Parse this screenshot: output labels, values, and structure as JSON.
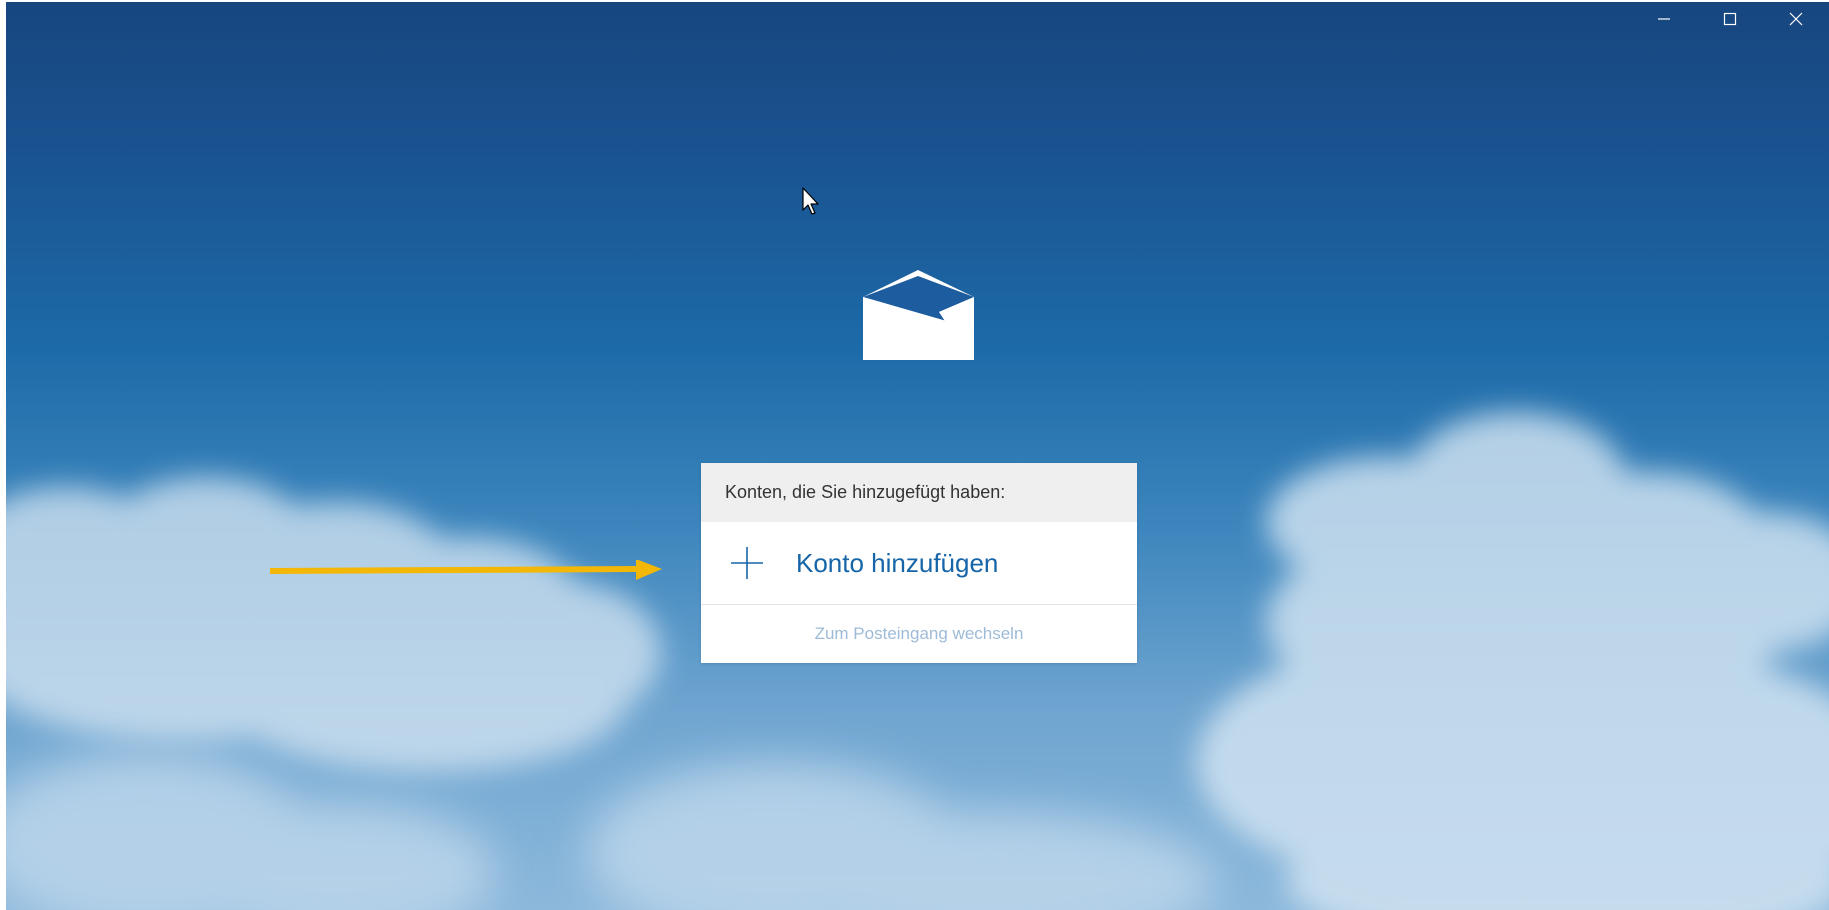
{
  "window": {
    "controls": [
      {
        "name": "minimize",
        "icon": "minimize-icon"
      },
      {
        "name": "maximize",
        "icon": "maximize-icon"
      },
      {
        "name": "close",
        "icon": "close-icon"
      }
    ]
  },
  "logo": {
    "icon": "mail-envelope-icon",
    "color": "#ffffff"
  },
  "account_panel": {
    "header": "Konten, die Sie hinzugefügt haben:",
    "add_account": {
      "label": "Konto hinzufügen",
      "icon": "plus-icon"
    },
    "inbox_link": "Zum Posteingang wechseln"
  },
  "annotation": {
    "icon": "arrow-right-icon",
    "color": "#f2b707"
  },
  "colors": {
    "accent": "#1565a8",
    "panel_header_bg": "#efefef",
    "link_muted": "#9dbbd6"
  }
}
